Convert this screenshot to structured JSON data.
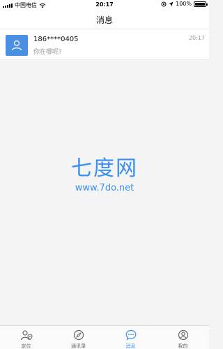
{
  "status_bar": {
    "carrier": "中国电信",
    "time": "20:17",
    "battery": "100%"
  },
  "header": {
    "title": "消息"
  },
  "messages": [
    {
      "name": "186****0405",
      "text": "你在哪呢?",
      "time": "20:17",
      "icon": "user-icon"
    }
  ],
  "watermark": {
    "title": "七度网",
    "url": "www.7do.net"
  },
  "tabs": [
    {
      "label": "定位",
      "icon": "location-icon",
      "active": false
    },
    {
      "label": "通讯录",
      "icon": "compass-icon",
      "active": false
    },
    {
      "label": "消息",
      "icon": "chat-icon",
      "active": true
    },
    {
      "label": "我的",
      "icon": "profile-icon",
      "active": false
    }
  ],
  "colors": {
    "accent": "#3b8ff0",
    "avatar_bg": "#4a90e2"
  }
}
